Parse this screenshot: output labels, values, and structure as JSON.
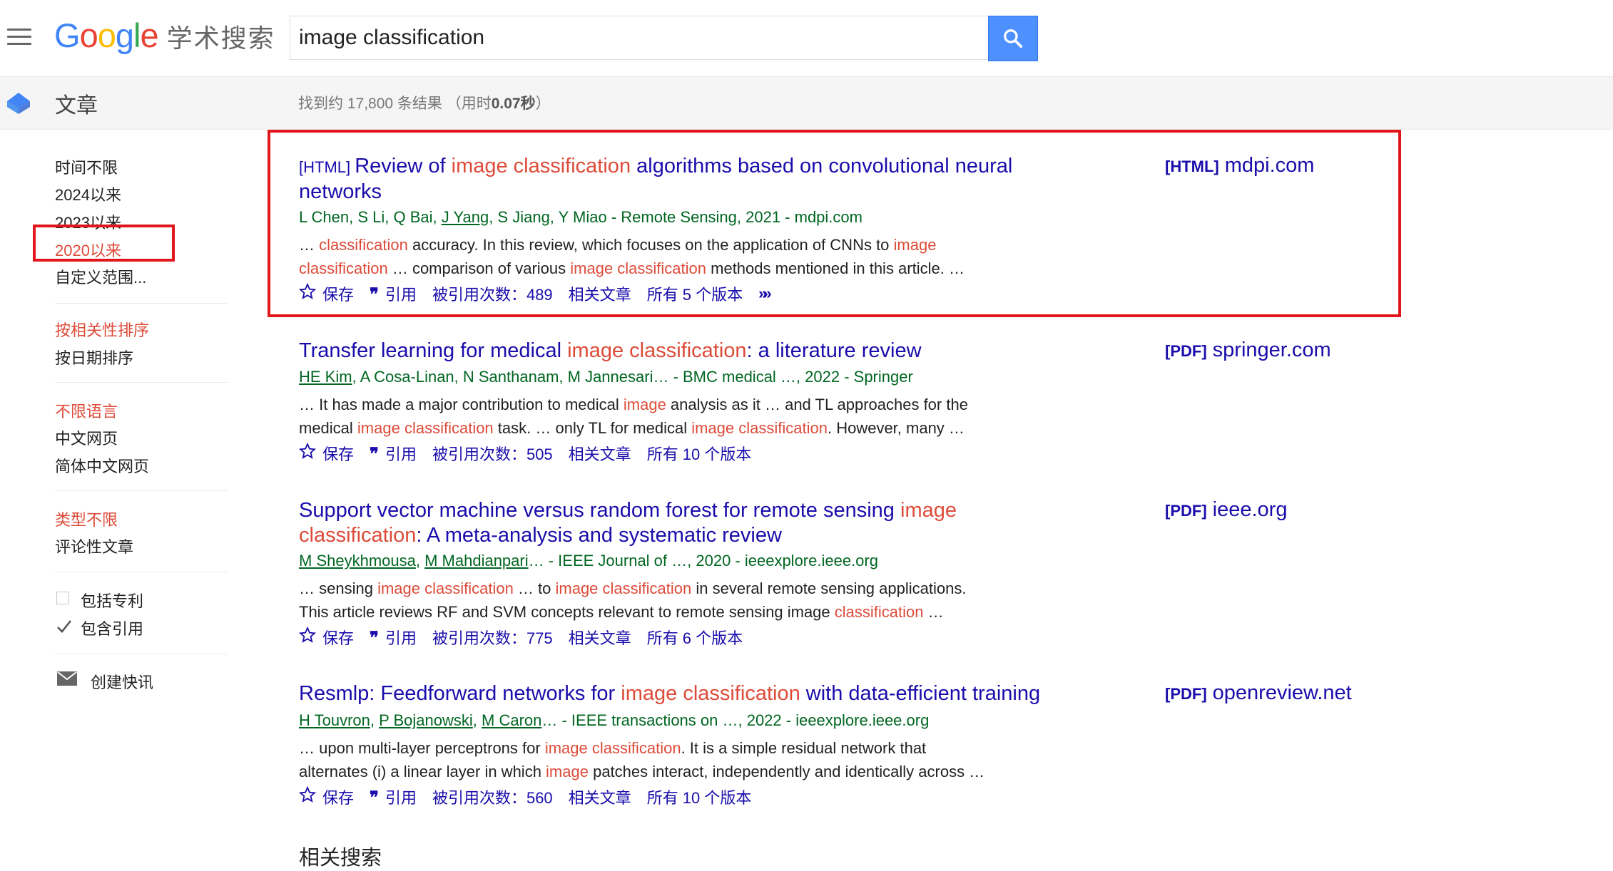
{
  "header": {
    "logo_letters": [
      {
        "ch": "G",
        "color": "#4285f4"
      },
      {
        "ch": "o",
        "color": "#ea4335"
      },
      {
        "ch": "o",
        "color": "#fbbc05"
      },
      {
        "ch": "g",
        "color": "#4285f4"
      },
      {
        "ch": "l",
        "color": "#34a853"
      },
      {
        "ch": "e",
        "color": "#ea4335"
      }
    ],
    "scholar_label": "学术搜索",
    "search_value": "image classification",
    "search_button_color": "#4d90fe"
  },
  "subheader": {
    "section_label": "文章",
    "result_count_prefix": "找到约 17,800 条结果 （用时",
    "result_time": "0.07秒",
    "result_count_suffix": "）"
  },
  "sidebar": {
    "time_filters": [
      "时间不限",
      "2024以来",
      "2023以来",
      "2020以来",
      "自定义范围..."
    ],
    "time_selected": "2020以来",
    "sort_options": [
      "按相关性排序",
      "按日期排序"
    ],
    "sort_selected": "按相关性排序",
    "language_options": [
      "不限语言",
      "中文网页",
      "简体中文网页"
    ],
    "language_selected": "不限语言",
    "type_options": [
      "类型不限",
      "评论性文章"
    ],
    "type_selected": "类型不限",
    "include_patents": {
      "label": "包括专利",
      "checked": false
    },
    "include_citations": {
      "label": "包含引用",
      "checked": true
    },
    "create_alert": "创建快讯"
  },
  "results": [
    {
      "prefix": "[HTML] ",
      "title_line1": [
        {
          "t": "Review of ",
          "h": false
        },
        {
          "t": "image classification",
          "h": true
        },
        {
          "t": " algorithms based on convolutional neural",
          "h": false
        }
      ],
      "title_line2": [
        {
          "t": "networks",
          "h": false
        }
      ],
      "authors": [
        {
          "t": "L Chen, S Li, Q Bai, ",
          "u": false
        },
        {
          "t": "J Yang",
          "u": true
        },
        {
          "t": ", S Jiang, Y Miao - Remote Sensing, 2021 - mdpi.com",
          "u": false
        }
      ],
      "snippet_line1": [
        {
          "t": "… ",
          "h": false
        },
        {
          "t": "classification",
          "h": true
        },
        {
          "t": " accuracy. In this review, which focuses on the application of CNNs to ",
          "h": false
        },
        {
          "t": "image",
          "h": true
        }
      ],
      "snippet_line2": [
        {
          "t": "classification",
          "h": true
        },
        {
          "t": " … comparison of various ",
          "h": false
        },
        {
          "t": "image classification",
          "h": true
        },
        {
          "t": " methods mentioned in this article. …",
          "h": false
        }
      ],
      "cited": "被引用次数：489",
      "versions": "所有 5 个版本",
      "side_tag": "[HTML]",
      "side_domain": "mdpi.com"
    },
    {
      "prefix": "",
      "title_line1": [
        {
          "t": "Transfer learning for medical ",
          "h": false
        },
        {
          "t": "image classification",
          "h": true
        },
        {
          "t": ": a literature review",
          "h": false
        }
      ],
      "title_line2": [],
      "authors": [
        {
          "t": "HE Kim",
          "u": true
        },
        {
          "t": ", A Cosa-Linan, N Santhanam, M Jannesari… - BMC medical …, 2022 - Springer",
          "u": false
        }
      ],
      "snippet_line1": [
        {
          "t": "… It has made a major contribution to medical ",
          "h": false
        },
        {
          "t": "image",
          "h": true
        },
        {
          "t": " analysis as it … and TL approaches for the",
          "h": false
        }
      ],
      "snippet_line2": [
        {
          "t": "medical ",
          "h": false
        },
        {
          "t": "image classification",
          "h": true
        },
        {
          "t": " task. … only TL for medical ",
          "h": false
        },
        {
          "t": "image classification",
          "h": true
        },
        {
          "t": ". However, many …",
          "h": false
        }
      ],
      "cited": "被引用次数：505",
      "versions": "所有 10 个版本",
      "side_tag": "[PDF]",
      "side_domain": "springer.com"
    },
    {
      "prefix": "",
      "title_line1": [
        {
          "t": "Support vector machine versus random forest for remote sensing ",
          "h": false
        },
        {
          "t": "image",
          "h": true
        }
      ],
      "title_line2": [
        {
          "t": "classification",
          "h": true
        },
        {
          "t": ": A meta-analysis and systematic review",
          "h": false
        }
      ],
      "authors": [
        {
          "t": "M Sheykhmousa",
          "u": true
        },
        {
          "t": ", ",
          "u": false
        },
        {
          "t": "M Mahdianpari",
          "u": true
        },
        {
          "t": "… - IEEE Journal of …, 2020 - ieeexplore.ieee.org",
          "u": false
        }
      ],
      "snippet_line1": [
        {
          "t": "… sensing ",
          "h": false
        },
        {
          "t": "image classification",
          "h": true
        },
        {
          "t": " … to ",
          "h": false
        },
        {
          "t": "image classification",
          "h": true
        },
        {
          "t": " in several remote sensing applications.",
          "h": false
        }
      ],
      "snippet_line2": [
        {
          "t": "This article reviews RF and SVM concepts relevant to remote sensing image ",
          "h": false
        },
        {
          "t": "classification",
          "h": true
        },
        {
          "t": " …",
          "h": false
        }
      ],
      "cited": "被引用次数：775",
      "versions": "所有 6 个版本",
      "side_tag": "[PDF]",
      "side_domain": "ieee.org"
    },
    {
      "prefix": "",
      "title_line1": [
        {
          "t": "Resmlp: Feedforward networks for ",
          "h": false
        },
        {
          "t": "image classification",
          "h": true
        },
        {
          "t": " with data-efficient training",
          "h": false
        }
      ],
      "title_line2": [],
      "authors": [
        {
          "t": "H Touvron",
          "u": true
        },
        {
          "t": ", ",
          "u": false
        },
        {
          "t": "P Bojanowski",
          "u": true
        },
        {
          "t": ", ",
          "u": false
        },
        {
          "t": "M Caron",
          "u": true
        },
        {
          "t": "… - IEEE transactions on …, 2022 - ieeexplore.ieee.org",
          "u": false
        }
      ],
      "snippet_line1": [
        {
          "t": "… upon multi-layer perceptrons for ",
          "h": false
        },
        {
          "t": "image classification",
          "h": true
        },
        {
          "t": ". It is a simple residual network that",
          "h": false
        }
      ],
      "snippet_line2": [
        {
          "t": "alternates (i) a linear layer in which ",
          "h": false
        },
        {
          "t": "image",
          "h": true
        },
        {
          "t": " patches interact, independently and identically across …",
          "h": false
        }
      ],
      "cited": "被引用次数：560",
      "versions": "所有 10 个版本",
      "side_tag": "[PDF]",
      "side_domain": "openreview.net"
    }
  ],
  "actions": {
    "save": "保存",
    "cite": "引用",
    "related": "相关文章"
  },
  "related_searches_label": "相关搜索",
  "colors": {
    "link": "#1a0dab",
    "highlight": "#dd4b39",
    "author": "#006621",
    "annotation_box": "#e0161c"
  }
}
